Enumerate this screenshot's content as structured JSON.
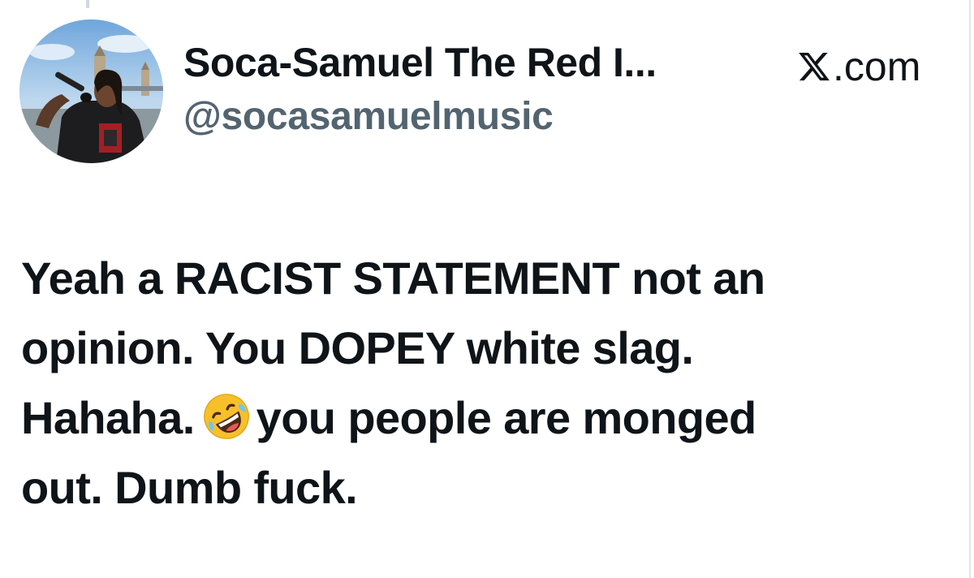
{
  "tweet": {
    "author": {
      "display_name": "Soca-Samuel The Red I...",
      "handle": "@socasamuelmusic",
      "avatar_icon": "profile-photo"
    },
    "source": {
      "logo_icon": "x-logo-icon",
      "label": ".com",
      "full_text": "X.com"
    },
    "text_lines": {
      "line1": "Yeah a RACIST STATEMENT not an",
      "line2": "opinion. You DOPEY white slag.",
      "line3_before_emoji": "Hahaha.",
      "emoji": "rolling-on-the-floor-laughing",
      "line3_after_emoji": "you people are monged",
      "line4": "out. Dumb fuck."
    }
  },
  "colors": {
    "text_primary": "#0f1419",
    "text_secondary": "#536471",
    "background": "#ffffff",
    "emoji_yellow": "#f7c02b"
  }
}
